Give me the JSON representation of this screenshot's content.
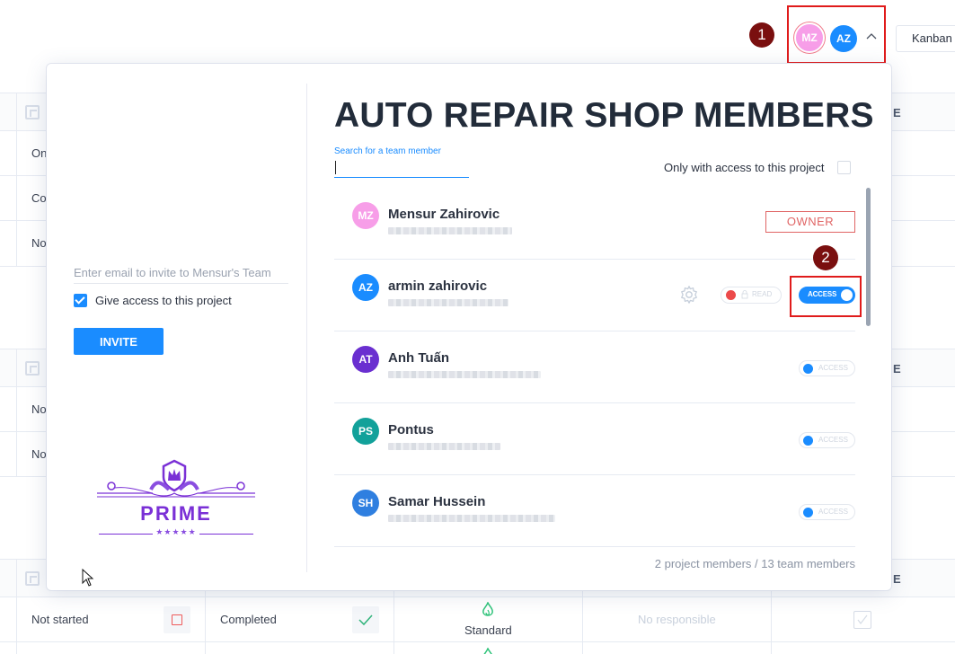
{
  "topbar": {
    "markers": [
      "1",
      "2"
    ],
    "avatars": [
      {
        "initials": "MZ",
        "color": "#f79ee8"
      },
      {
        "initials": "AZ",
        "color": "#1a8cff"
      }
    ],
    "view_button": "Kanban"
  },
  "board": {
    "visible_status_fragments": [
      "On",
      "Co",
      "No",
      "No",
      "No"
    ],
    "column_header_fragment": "E",
    "bottom_row": {
      "status": "Not started",
      "status2": "Completed",
      "priority": "Standard",
      "responsible": "No responsible"
    }
  },
  "modal": {
    "title": "AUTO REPAIR SHOP MEMBERS",
    "invite": {
      "email_placeholder": "Enter email to invite to Mensur's Team",
      "give_access_label": "Give access to this project",
      "give_access_checked": true,
      "invite_button": "INVITE"
    },
    "logo": {
      "text": "PRIME",
      "stars": "★★★★★"
    },
    "search": {
      "label": "Search for a team member",
      "value": ""
    },
    "filter": {
      "label": "Only with access to this project",
      "checked": false
    },
    "members": [
      {
        "initials": "MZ",
        "name": "Mensur Zahirovic",
        "avatar_color": "#f79ee8",
        "role": "OWNER"
      },
      {
        "initials": "AZ",
        "name": "armin zahirovic",
        "avatar_color": "#1a8cff",
        "read_label": "READ",
        "access_label": "ACCESS",
        "access": true
      },
      {
        "initials": "AT",
        "name": "Anh Tuấn",
        "avatar_color": "#6a2fd0",
        "access_label": "ACCESS",
        "access": false
      },
      {
        "initials": "PS",
        "name": "Pontus",
        "avatar_color": "#12a19a",
        "access_label": "ACCESS",
        "access": false
      },
      {
        "initials": "SH",
        "name": "Samar Hussein",
        "avatar_color": "#2f7fe0",
        "access_label": "ACCESS",
        "access": false
      }
    ],
    "footer": "2 project members / 13 team members"
  },
  "colors": {
    "accent": "#1a8cff",
    "owner_red": "#e06565",
    "marker": "#7a0f0f",
    "highlight": "#e01b1b",
    "logo_purple": "#7a30d6"
  }
}
